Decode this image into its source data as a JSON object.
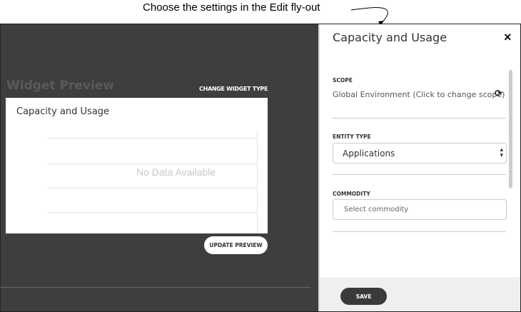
{
  "caption": "Choose the settings in the Edit fly-out",
  "preview": {
    "title": "Widget Preview",
    "change_type": "CHANGE WIDGET TYPE",
    "card_title": "Capacity and Usage",
    "no_data": "No Data Available",
    "update_button": "UPDATE PREVIEW"
  },
  "flyout": {
    "title": "Capacity and Usage",
    "close_icon": "×",
    "scope_label": "SCOPE",
    "scope_value": "Global Environment (Click to change scope)",
    "refresh_icon": "⟳",
    "entity_label": "ENTITY TYPE",
    "entity_value": "Applications",
    "commodity_label": "COMMODITY",
    "commodity_placeholder": "Select commodity",
    "save_button": "SAVE"
  }
}
